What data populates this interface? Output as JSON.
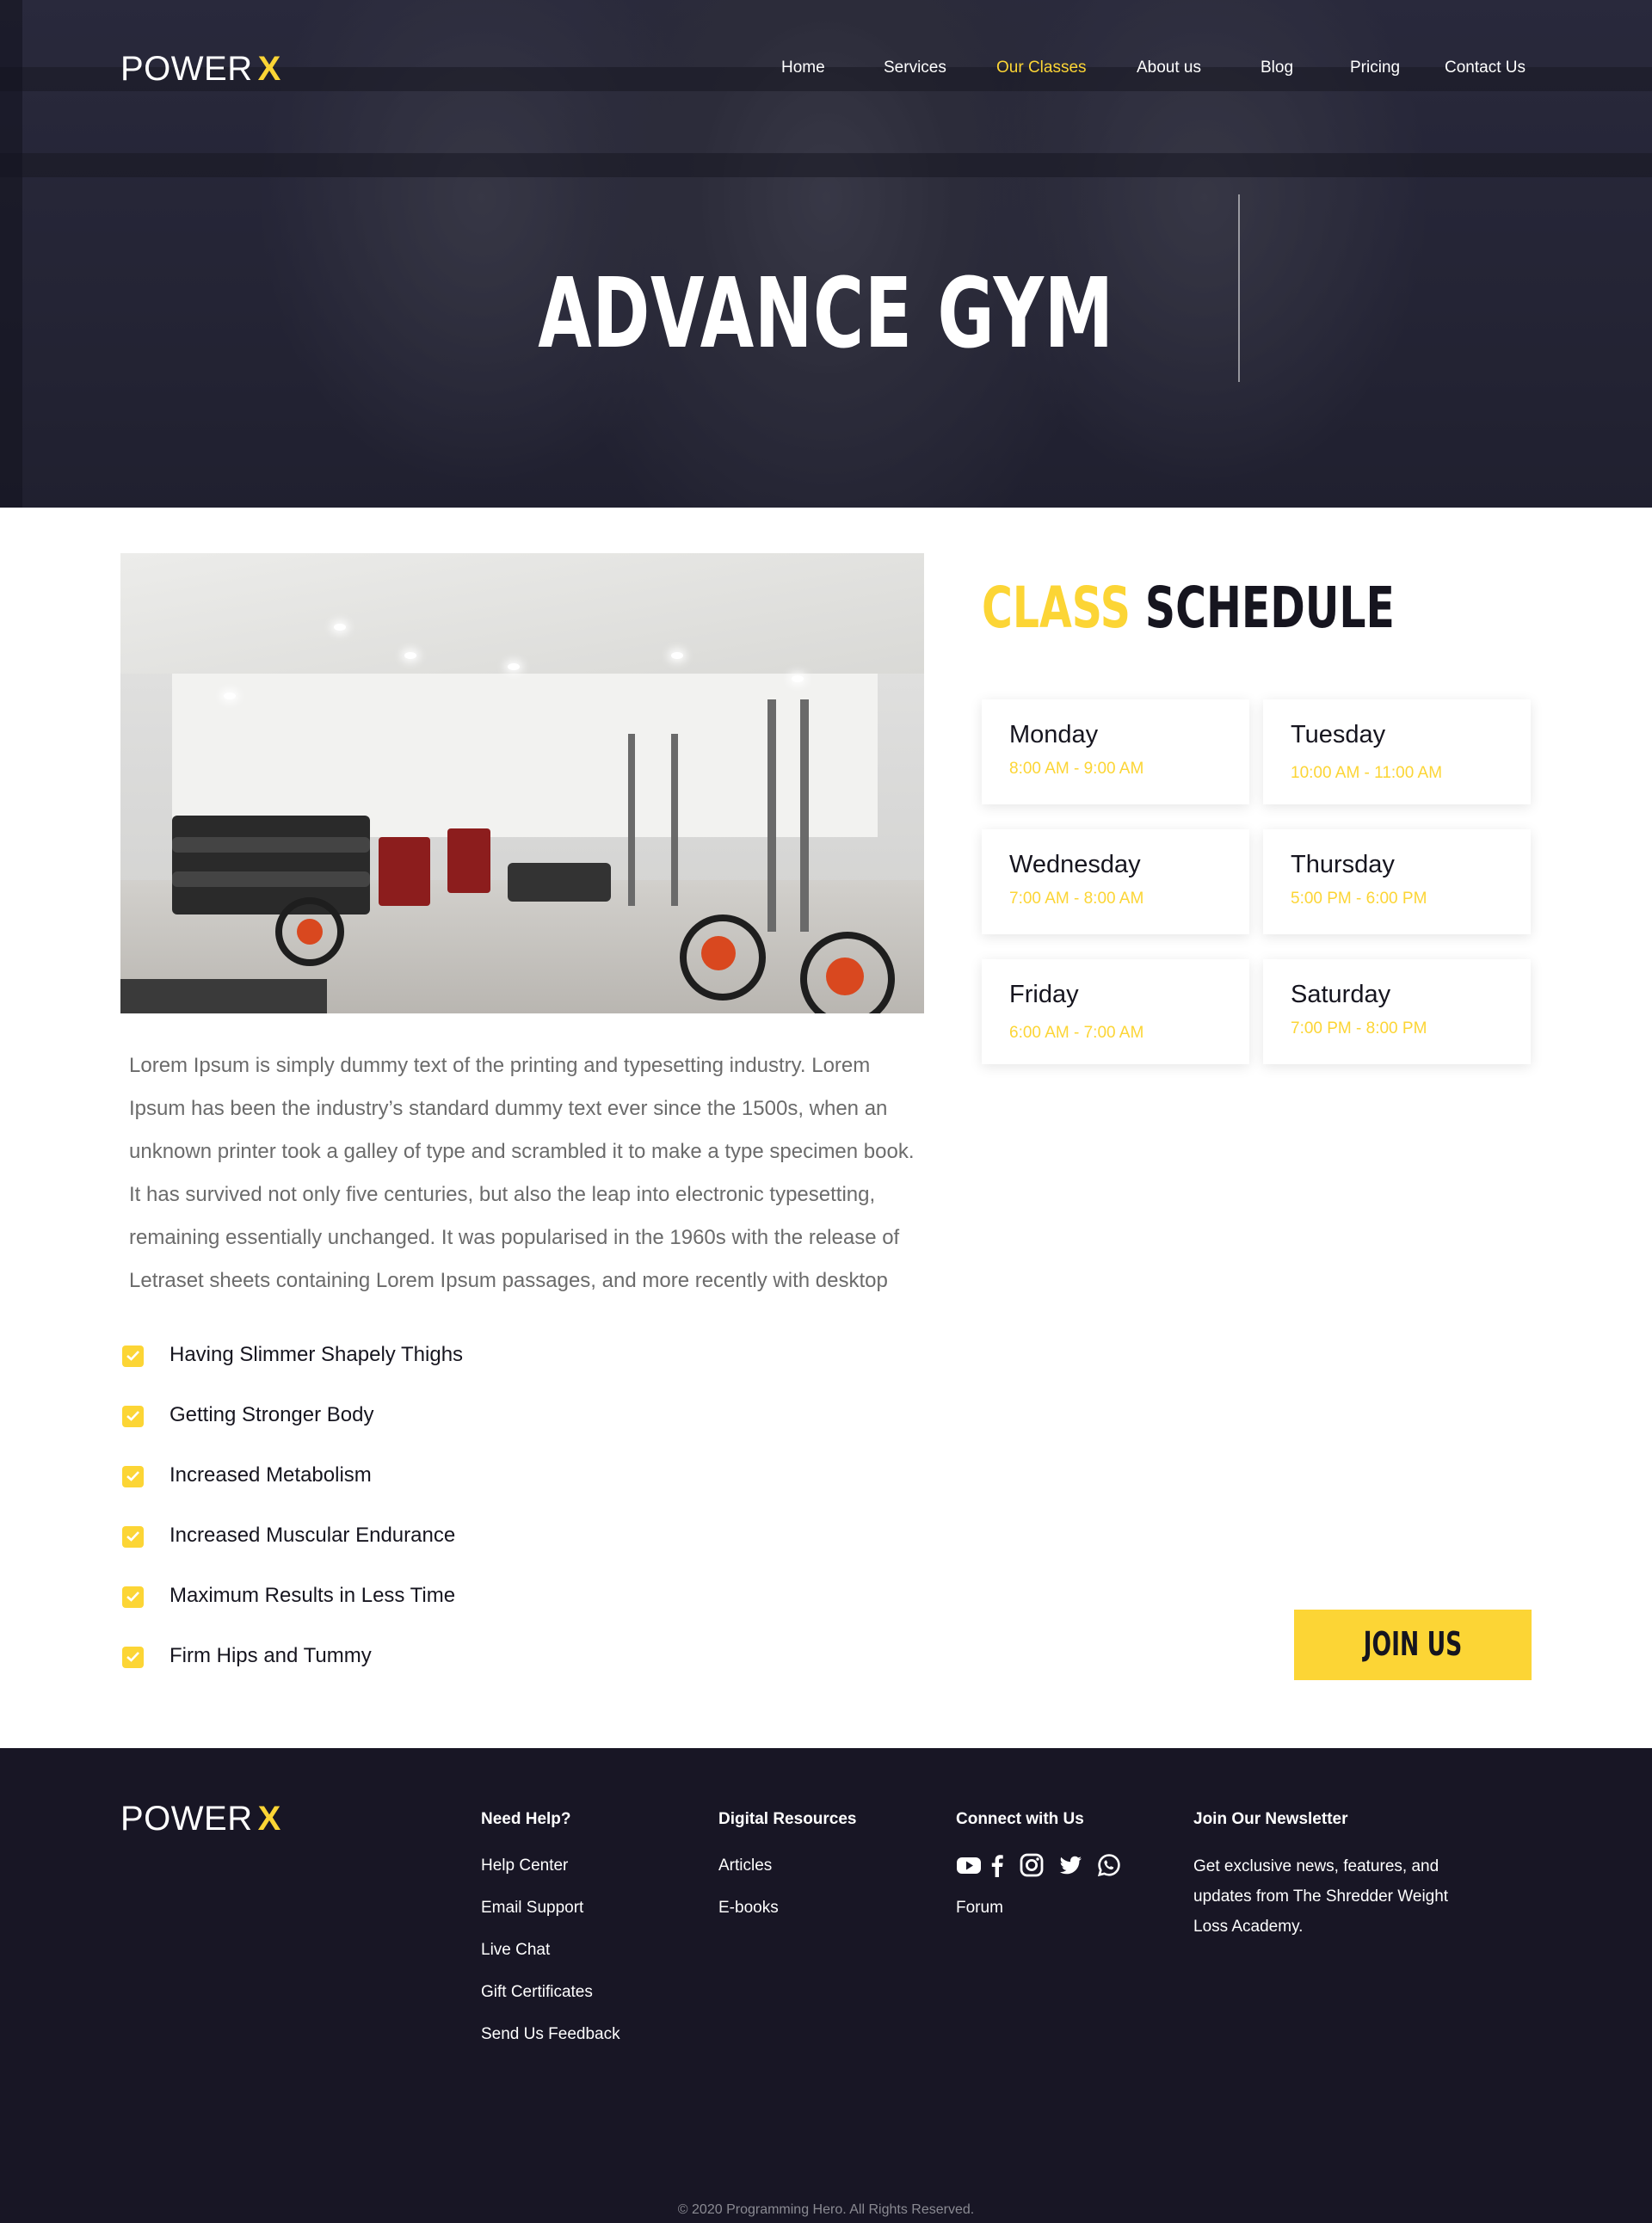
{
  "brand": {
    "name": "POWER",
    "mark": "X"
  },
  "nav": {
    "items": [
      {
        "label": "Home"
      },
      {
        "label": "Services"
      },
      {
        "label": "Our Classes"
      },
      {
        "label": "About us"
      },
      {
        "label": "Blog"
      },
      {
        "label": "Pricing"
      },
      {
        "label": "Contact Us"
      }
    ],
    "active": "Our Classes"
  },
  "hero": {
    "title": "ADVANCE GYM"
  },
  "about": {
    "body": "Lorem Ipsum is simply dummy text of the printing and typesetting industry. Lorem Ipsum has been the industry’s standard dummy text ever since the 1500s, when an unknown printer took a galley of type and scrambled it to make a type specimen book. It has survived not only five centuries, but also the leap into electronic typesetting, remaining essentially unchanged. It was popularised in the 1960s with the release of Letraset sheets containing Lorem Ipsum passages, and more recently with desktop",
    "benefits": [
      "Having Slimmer Shapely Thighs",
      "Getting Stronger Body",
      "Increased Metabolism",
      "Increased Muscular Endurance",
      "Maximum Results in Less Time",
      "Firm Hips and Tummy"
    ]
  },
  "schedule": {
    "title_accent": "CLASS",
    "title_rest": "SCHEDULE",
    "days": [
      {
        "day": "Monday",
        "time": "8:00 AM - 9:00 AM"
      },
      {
        "day": "Tuesday",
        "time": "10:00 AM - 11:00 AM"
      },
      {
        "day": "Wednesday",
        "time": "7:00 AM - 8:00 AM"
      },
      {
        "day": "Thursday",
        "time": "5:00 PM - 6:00 PM"
      },
      {
        "day": "Friday",
        "time": "6:00 AM - 7:00 AM"
      },
      {
        "day": "Saturday",
        "time": "7:00 PM - 8:00 PM"
      }
    ],
    "cta": "JOIN US"
  },
  "footer": {
    "need_help": {
      "heading": "Need Help?",
      "links": [
        "Help Center",
        "Email Support",
        "Live Chat",
        "Gift Certificates",
        "Send Us Feedback"
      ]
    },
    "digital_resources": {
      "heading": "Digital Resources",
      "links": [
        "Articles",
        "E-books"
      ]
    },
    "connect": {
      "heading": "Connect with Us",
      "icons": [
        "youtube-icon",
        "facebook-icon",
        "instagram-icon",
        "twitter-icon",
        "whatsapp-icon"
      ],
      "links": [
        "Forum"
      ]
    },
    "newsletter": {
      "heading": "Join Our Newsletter",
      "text": "Get exclusive news, features, and updates from The Shredder Weight Loss Academy."
    },
    "copyright": "© 2020 Programming Hero. All Rights Reserved."
  },
  "colors": {
    "accent": "#fcd535",
    "dark": "#16151f",
    "footer_bg": "#181625"
  }
}
